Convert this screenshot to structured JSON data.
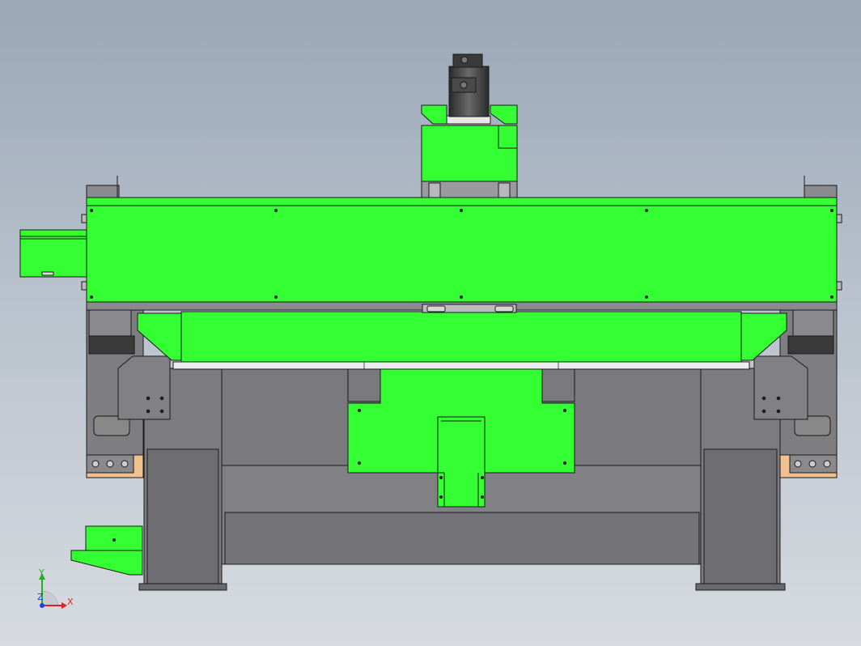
{
  "viewport": {
    "background_top": "#9aa7b7",
    "background_bottom": "#d7dbe0"
  },
  "colors": {
    "part_green": "#33ff33",
    "frame_gray": "#7a7a7e",
    "frame_dark": "#3a3a3a",
    "base_tan": "#f0c090",
    "edge": "#1a1a1a"
  },
  "triad": {
    "x_label": "X",
    "y_label": "Y",
    "z_label": "Z",
    "x_color": "#e02020",
    "y_color": "#20b020",
    "z_color": "#2040e0"
  }
}
